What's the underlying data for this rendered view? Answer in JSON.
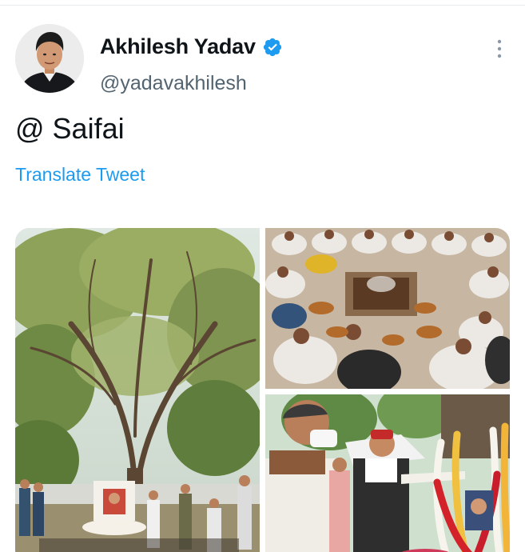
{
  "tweet": {
    "author_name": "Akhilesh Yadav",
    "handle": "@yadavakhilesh",
    "text": "@ Saifai",
    "translate_label": "Translate Tweet",
    "verified": true
  },
  "icons": {
    "verified": "verified-badge-icon",
    "more": "more-options-icon"
  },
  "colors": {
    "link": "#1d9bf0",
    "verified": "#1d9bf0",
    "secondary_text": "#536471",
    "primary_text": "#0f1419"
  },
  "media": [
    {
      "label": "tree-memorial-photo"
    },
    {
      "label": "havan-ceremony-photo"
    },
    {
      "label": "tribute-garland-photo"
    }
  ]
}
